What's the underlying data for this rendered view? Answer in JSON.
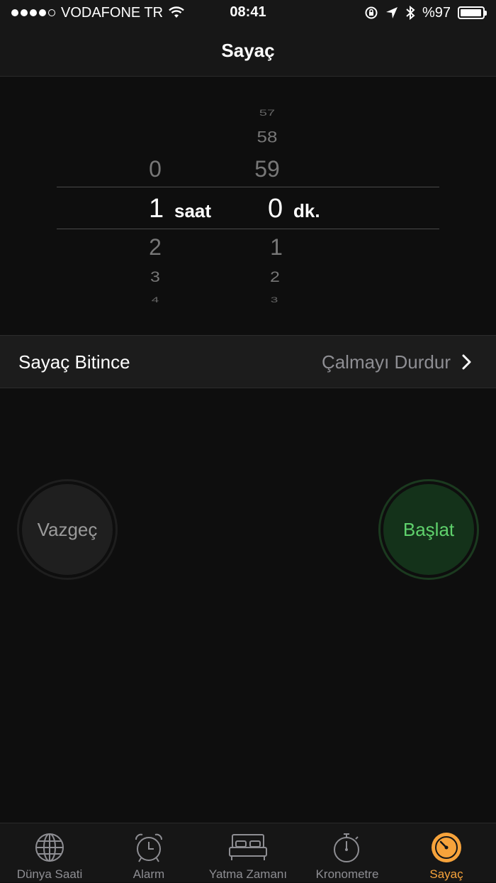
{
  "status_bar": {
    "carrier": "VODAFONE TR",
    "time": "08:41",
    "battery_text": "%97",
    "battery_level": 0.97
  },
  "nav": {
    "title": "Sayaç"
  },
  "picker": {
    "hours": {
      "above": [
        "0"
      ],
      "selected": "1",
      "below": [
        "2",
        "3",
        "4"
      ],
      "unit": "saat"
    },
    "minutes": {
      "above": [
        "57",
        "58",
        "59"
      ],
      "selected": "0",
      "below": [
        "1",
        "2",
        "3"
      ],
      "unit": "dk."
    }
  },
  "when_done": {
    "label": "Sayaç Bitince",
    "value": "Çalmayı Durdur"
  },
  "buttons": {
    "cancel": "Vazgeç",
    "start": "Başlat"
  },
  "tabs": [
    {
      "label": "Dünya Saati",
      "icon": "globe-icon"
    },
    {
      "label": "Alarm",
      "icon": "alarm-clock-icon"
    },
    {
      "label": "Yatma Zamanı",
      "icon": "bed-icon"
    },
    {
      "label": "Kronometre",
      "icon": "stopwatch-icon"
    },
    {
      "label": "Sayaç",
      "icon": "timer-icon",
      "active": true
    }
  ],
  "colors": {
    "accent": "#f7a33b",
    "start_green": "#5fd16c",
    "background": "#0e0e0e"
  }
}
